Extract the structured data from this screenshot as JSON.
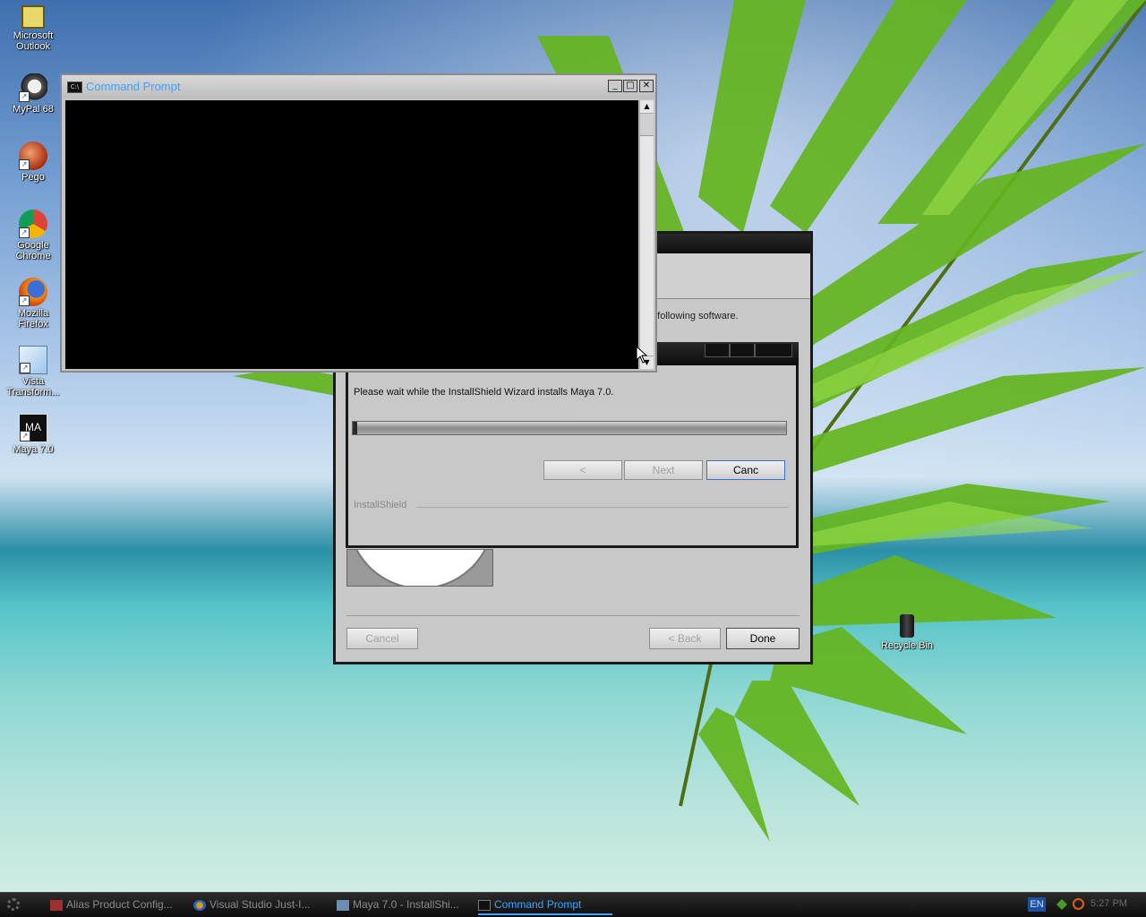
{
  "desktop": {
    "icons": [
      {
        "label": "Microsoft Outlook"
      },
      {
        "label": "MyPal 68"
      },
      {
        "label": "Pego"
      },
      {
        "label": "Google Chrome"
      },
      {
        "label": "Mozilla Firefox"
      },
      {
        "label": "Vista Transform..."
      },
      {
        "label": "Maya 7.0"
      }
    ],
    "recycle_bin": "Recycle Bin"
  },
  "cmd_window": {
    "title": "Command Prompt",
    "min": "_",
    "max": "□",
    "close": "✕"
  },
  "install_back": {
    "partial_text": "e following software.",
    "buttons": {
      "cancel": "Cancel",
      "back": "< Back",
      "done": "Done"
    }
  },
  "install_front": {
    "message": "Please wait while the InstallShield Wizard installs Maya 7.0.",
    "progress_fraction": 0.01,
    "buttons": {
      "back": "<",
      "next": "Next",
      "cancel": "Canc"
    },
    "brand": "InstallShield"
  },
  "taskbar": {
    "items": [
      {
        "label": "Alias Product Config..."
      },
      {
        "label": "Visual Studio Just-I..."
      },
      {
        "label": "Maya 7.0 - InstallShi..."
      },
      {
        "label": "Command Prompt"
      }
    ],
    "lang": "EN",
    "clock": "5:27 PM"
  },
  "colors": {
    "cmd_title_text": "#3fa2ff",
    "taskbar_bg": "#1b1b1b",
    "dialog_bg": "#c8c8c8"
  }
}
